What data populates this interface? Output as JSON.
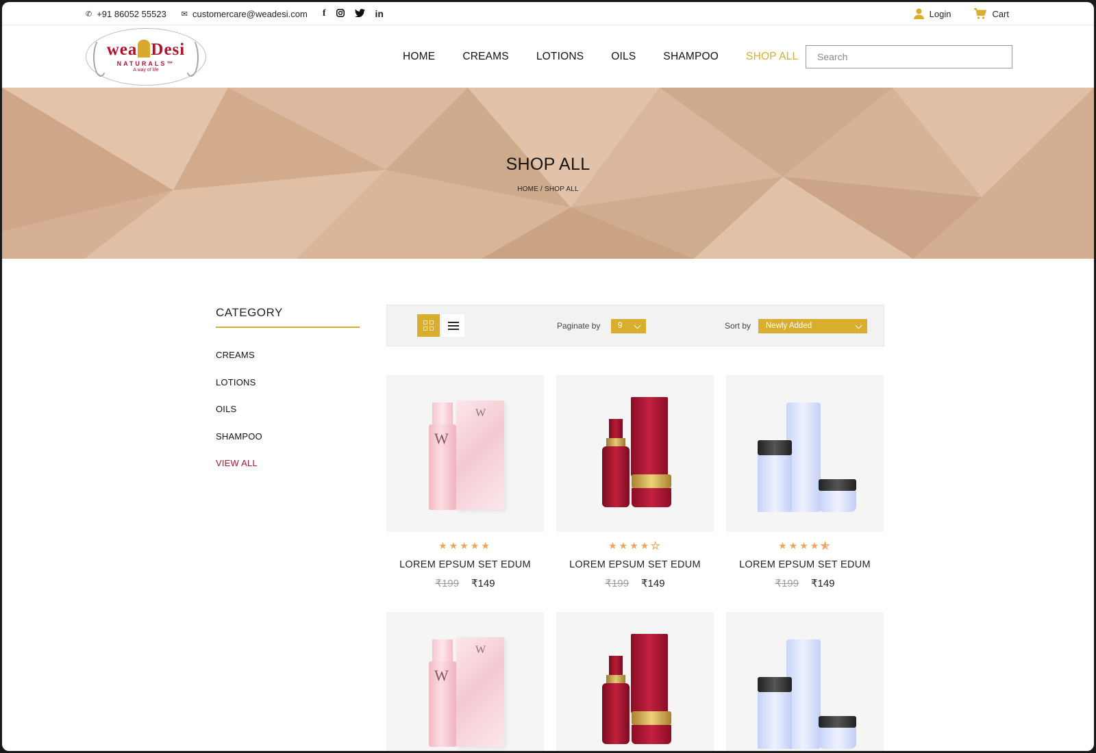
{
  "topbar": {
    "phone": "+91 86052 55523",
    "email": "customercare@weadesi.com",
    "social": [
      "f",
      "ig",
      "tw",
      "in"
    ],
    "login": "Login",
    "cart": "Cart"
  },
  "logo": {
    "brand_left": "wea",
    "brand_right": "Desi",
    "subtitle": "NATURALS™",
    "tagline": "A way of life"
  },
  "nav": {
    "items": [
      "HOME",
      "CREAMS",
      "LOTIONS",
      "OILS",
      "SHAMPOO",
      "SHOP ALL"
    ],
    "active_index": 5
  },
  "search": {
    "placeholder": "Search",
    "value": ""
  },
  "hero": {
    "title": "SHOP ALL",
    "breadcrumb": "HOME / SHOP ALL"
  },
  "sidebar": {
    "heading": "CATEGORY",
    "items": [
      "CREAMS",
      "LOTIONS",
      "OILS",
      "SHAMPOO",
      "VIEW ALL"
    ]
  },
  "toolbar": {
    "paginate_label": "Paginate by",
    "paginate_value": "9",
    "sort_label": "Sort by",
    "sort_value": "Newly Added",
    "active_view": "grid"
  },
  "products": [
    {
      "name": "LOREM EPSUM SET EDUM",
      "old_price": "₹199",
      "price": "₹149",
      "rating": 5,
      "image": "pink-set"
    },
    {
      "name": "LOREM EPSUM SET EDUM",
      "old_price": "₹199",
      "price": "₹149",
      "rating": 4,
      "image": "red-set"
    },
    {
      "name": "LOREM EPSUM SET EDUM",
      "old_price": "₹199",
      "price": "₹149",
      "rating": 4.5,
      "image": "blue-set"
    },
    {
      "image": "pink-set"
    },
    {
      "image": "red-set"
    },
    {
      "image": "blue-set"
    }
  ],
  "colors": {
    "accent": "#d9ad2e",
    "brand_red": "#b3122f",
    "star": "#f3a35a",
    "hero_bg": "#d9b79d"
  }
}
